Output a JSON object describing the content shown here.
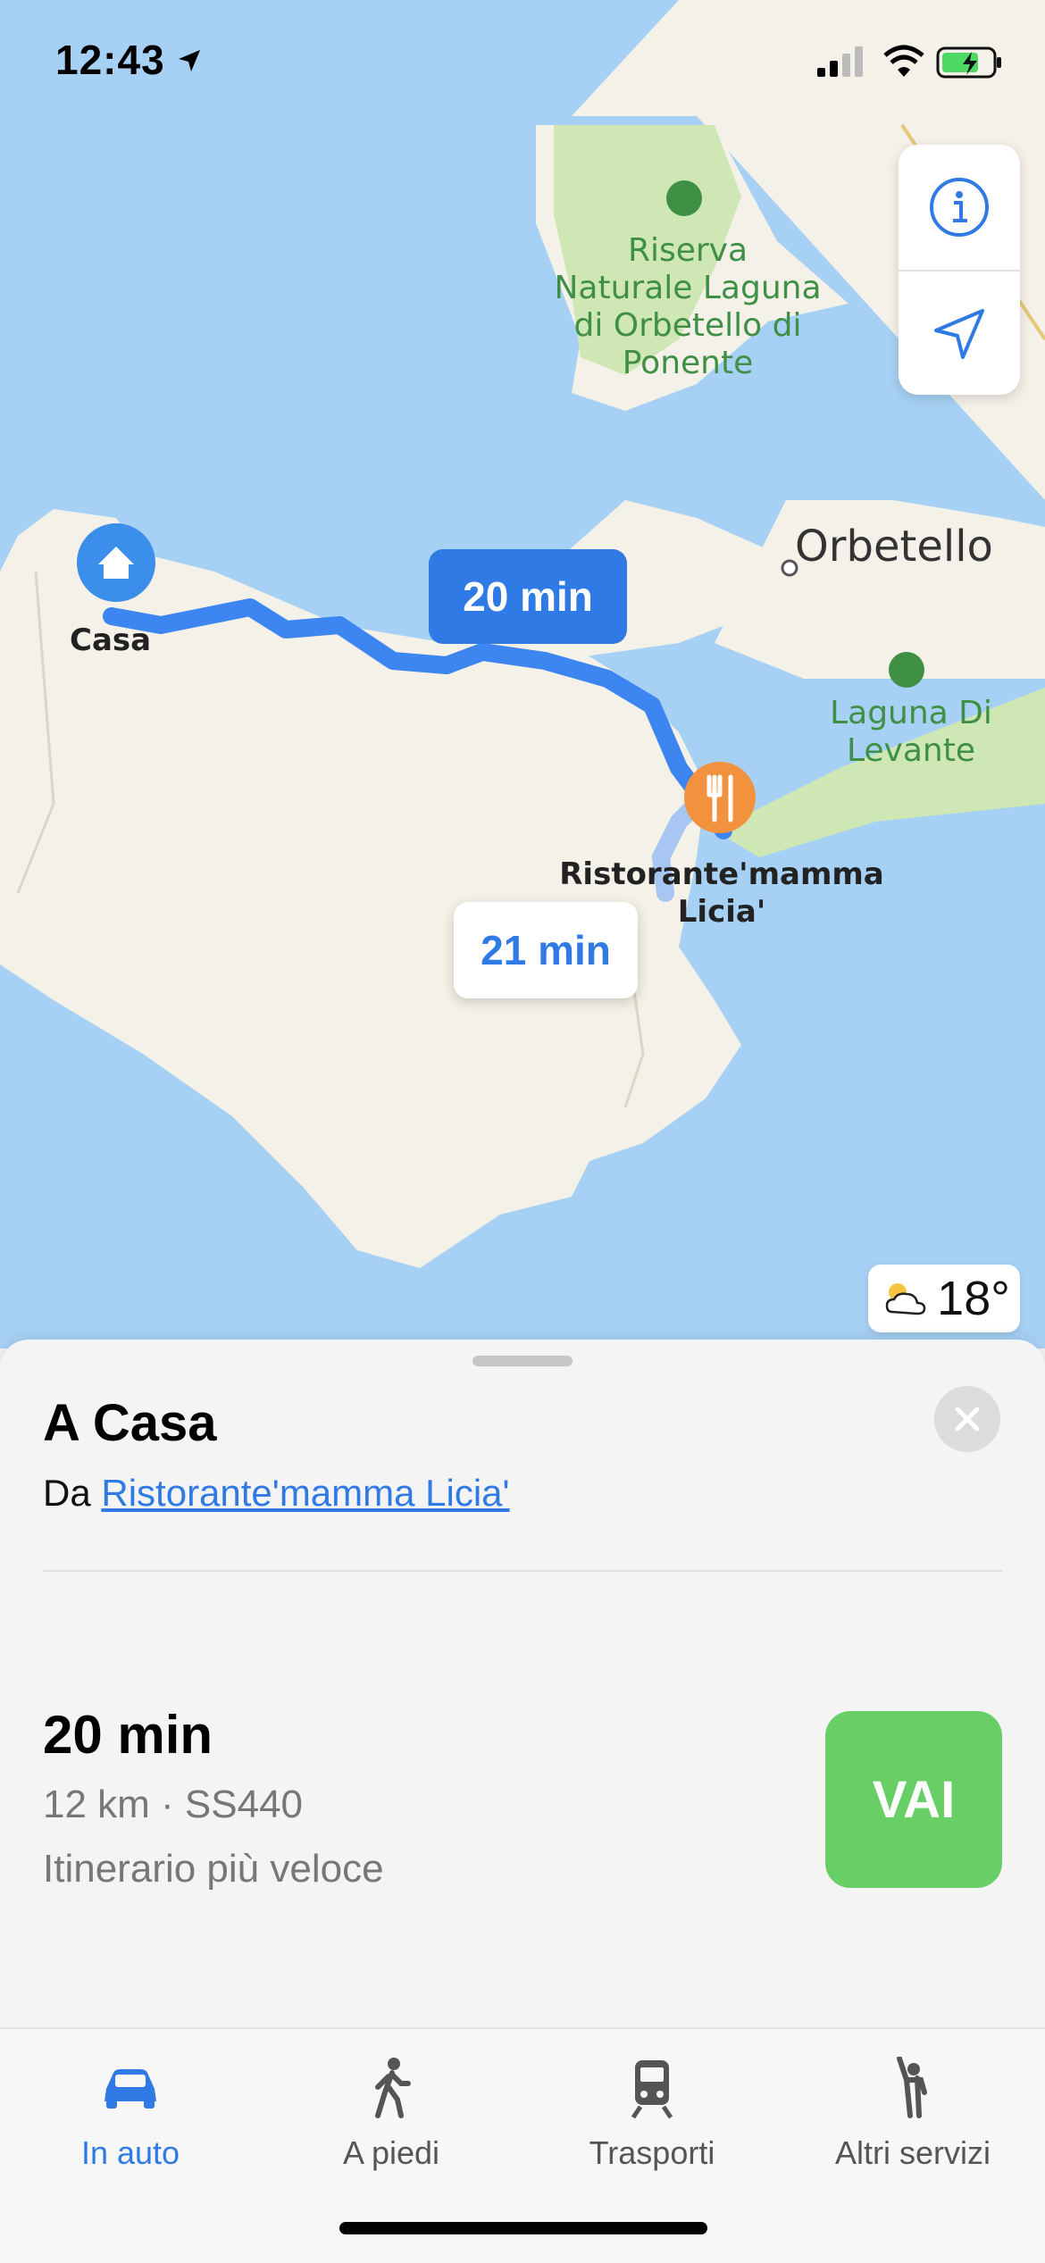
{
  "status_bar": {
    "time": "12:43"
  },
  "map": {
    "labels": {
      "park_north": "Riserva\nNaturale Laguna\ndi Orbetello di\nPonente",
      "town": "Orbetello",
      "park_east": "Laguna Di\nLevante",
      "home": "Casa",
      "restaurant": "Ristorante'mamma\nLicia'"
    },
    "route_primary_time": "20 min",
    "route_alt_time": "21 min",
    "weather_temp": "18°",
    "colors": {
      "water": "#a7d1f4",
      "land": "#f4f1e8",
      "park": "#cfe7b4",
      "route": "#3d85f0",
      "restaurant_pin": "#f2913e"
    }
  },
  "sheet": {
    "title": "A Casa",
    "from_prefix": "Da",
    "from_link": "Ristorante'mamma Licia'",
    "duration": "20 min",
    "distance": "12 km · SS440",
    "route_note": "Itinerario più veloce",
    "go_label": "VAI"
  },
  "tabbar": {
    "items": [
      {
        "label": "In auto",
        "icon": "car-icon",
        "active": true
      },
      {
        "label": "A piedi",
        "icon": "walking-icon",
        "active": false
      },
      {
        "label": "Trasporti",
        "icon": "train-icon",
        "active": false
      },
      {
        "label": "Altri servizi",
        "icon": "hail-icon",
        "active": false
      }
    ]
  }
}
